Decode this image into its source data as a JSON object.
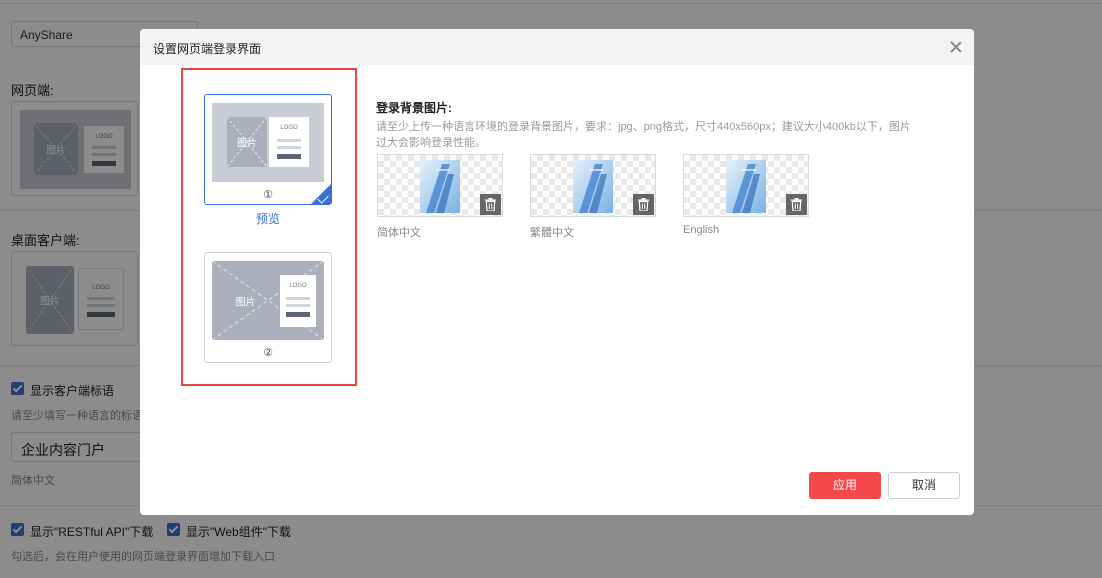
{
  "background": {
    "app_input_value": "AnyShare",
    "web_label": "网页端:",
    "desktop_label": "桌面客户端:",
    "show_client_slogan_label": "显示客户端标语",
    "slogan_hint": "请至少填写一种语言的标语",
    "slogan_value": "企业内容门户",
    "slogan_lang": "简体中文",
    "restful_label": "显示\"RESTful API\"下载",
    "web_component_label": "显示\"Web组件\"下载",
    "download_hint": "勾选后，会在用户使用的网页端登录界面增加下载入口",
    "mini_img_text": "图片",
    "mini_logo_text": "LOGO"
  },
  "modal": {
    "title": "设置网页端登录界面",
    "templates": [
      {
        "number": "①",
        "img_text": "图片",
        "logo_text": "LOGO",
        "selected": true
      },
      {
        "number": "②",
        "img_text": "图片",
        "logo_text": "LOGO",
        "selected": false
      }
    ],
    "preview_label": "预览",
    "bg_section_title": "登录背景图片:",
    "bg_section_desc": "请至少上传一种语言环境的登录背景图片，要求：jpg、png格式，尺寸440x560px；建议大小400kb以下，图片过大会影响登录性能。",
    "bg_images": [
      {
        "caption": "简体中文"
      },
      {
        "caption": "繁體中文"
      },
      {
        "caption": "English"
      }
    ],
    "apply_label": "应用",
    "cancel_label": "取消"
  },
  "colors": {
    "accent": "#3a6fd8",
    "apply": "#f4484a",
    "highlight": "#e8473f"
  }
}
